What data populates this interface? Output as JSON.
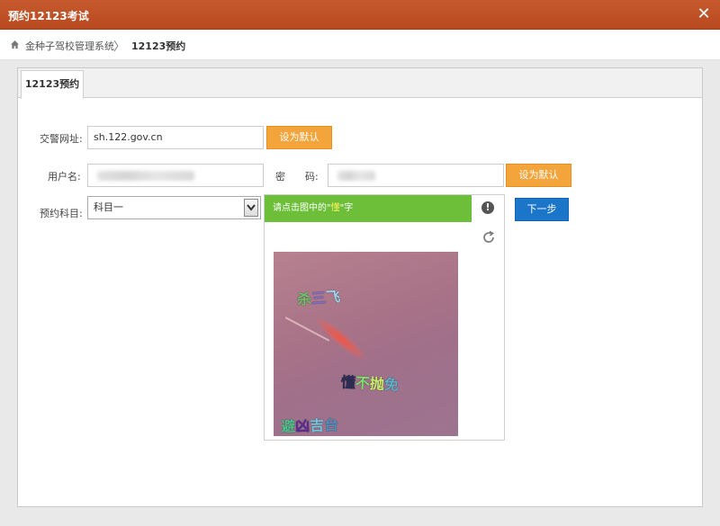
{
  "window": {
    "title": "预约12123考试",
    "close_symbol": "✕"
  },
  "breadcrumb": {
    "items": [
      "金种子驾校管理系统",
      "12123预约"
    ],
    "separator": "〉"
  },
  "tabs": [
    {
      "label": "12123预约"
    }
  ],
  "form": {
    "traffic_site": {
      "label": "交警网址:",
      "value": "sh.122.gov.cn",
      "default_button": "设为默认"
    },
    "username": {
      "label": "用户名:"
    },
    "password": {
      "label": "密　　码:",
      "default_button": "设为默认"
    },
    "subject": {
      "label": "预约科目:",
      "selected": "科目一"
    },
    "next_button": "下一步"
  },
  "captcha": {
    "prompt_before": "请点击图中的\"",
    "prompt_char": "懂",
    "prompt_after": "\"字",
    "warn_symbol": "!",
    "words": [
      {
        "text": "杀三飞",
        "colors": [
          "#6fbf6a",
          "#7d6fd0",
          "#9ad6f0"
        ]
      },
      {
        "text": "懂不抛免",
        "colors": [
          "#2b2b55",
          "#7ee06a",
          "#c9f06a",
          "#5ab0c8"
        ]
      },
      {
        "text": "避凶吉台",
        "colors": [
          "#4ac08a",
          "#5a2a9a",
          "#6fc7e0",
          "#4a90c0"
        ]
      }
    ]
  },
  "colors": {
    "titlebar": "#c0532a",
    "orange_button": "#f3a43a",
    "blue_button": "#1b75c9",
    "captcha_bar": "#6dbf3a"
  }
}
